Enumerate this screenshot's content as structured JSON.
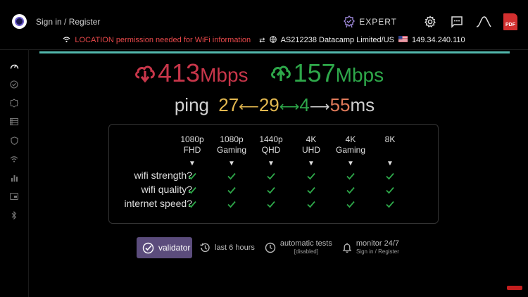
{
  "header": {
    "signin_label": "Sign in / Register",
    "expert_label": "EXPERT",
    "pdf_label": "PDF"
  },
  "infobar": {
    "warning": "LOCATION permission needed for WiFi information",
    "isp": "AS212238 Datacamp Limited/US",
    "ip": "149.34.240.110"
  },
  "speed": {
    "download_value": "413",
    "download_unit": "Mbps",
    "upload_value": "157",
    "upload_unit": "Mbps"
  },
  "ping": {
    "label": "ping",
    "min": "27",
    "max": "29",
    "jitter": "4",
    "loaded": "55",
    "unit": "ms"
  },
  "matrix": {
    "columns": [
      {
        "line1": "1080p",
        "line2": "FHD"
      },
      {
        "line1": "1080p",
        "line2": "Gaming"
      },
      {
        "line1": "1440p",
        "line2": "QHD"
      },
      {
        "line1": "4K",
        "line2": "UHD"
      },
      {
        "line1": "4K",
        "line2": "Gaming"
      },
      {
        "line1": "8K",
        "line2": ""
      }
    ],
    "rows": [
      "wifi strength?",
      "wifi quality?",
      "internet speed?"
    ],
    "triangle": "▼",
    "check_color": "#2ea84a"
  },
  "bottom": {
    "validator_label": "validator",
    "history_label": "last 6 hours",
    "auto_label": "automatic tests",
    "auto_sub": "[disabled]",
    "monitor_label": "monitor 24/7",
    "monitor_sub": "Sign in / Register"
  },
  "colors": {
    "download": "#c8364a",
    "upload": "#2ea84a",
    "accent": "#52b7ac",
    "validator_bg": "#5b4c7c"
  }
}
